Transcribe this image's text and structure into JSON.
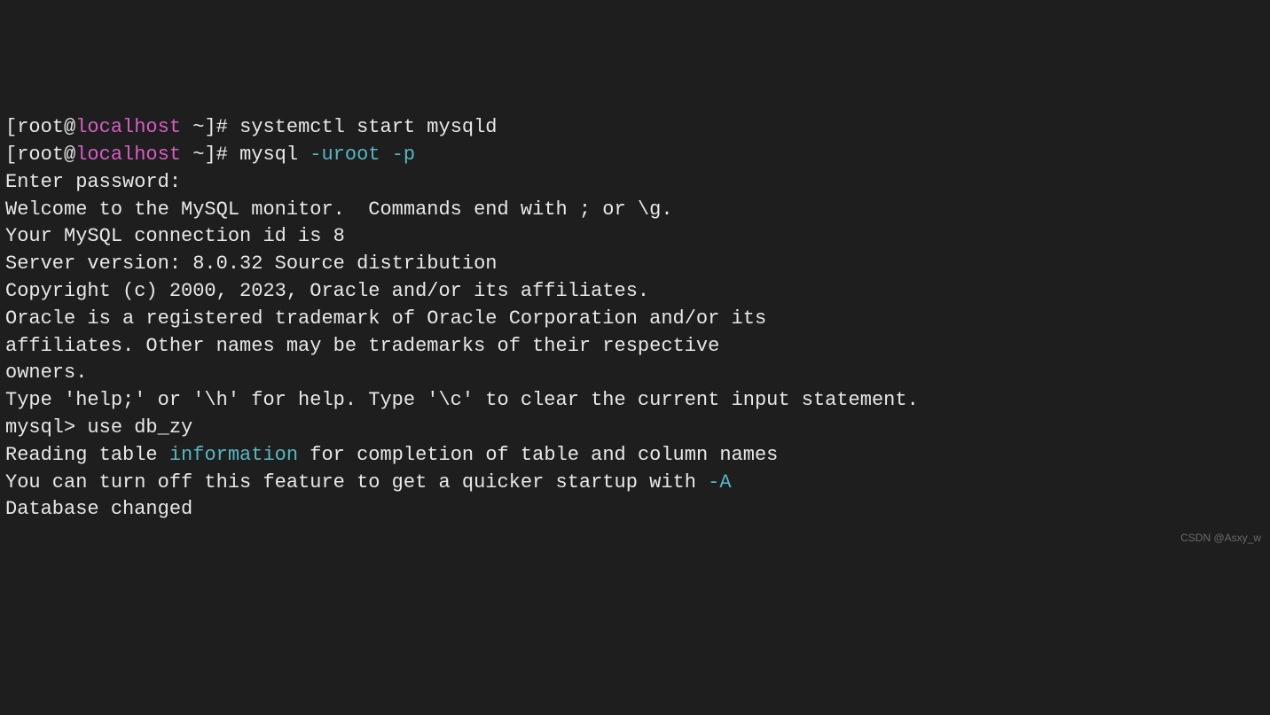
{
  "prompt1": {
    "open": "[",
    "user": "root",
    "at": "@",
    "host": "localhost",
    "rest": " ~]# ",
    "cmd": "systemctl start mysqld"
  },
  "prompt2": {
    "open": "[",
    "user": "root",
    "at": "@",
    "host": "localhost",
    "rest": " ~]# ",
    "cmd": "mysql ",
    "flag1": "-uroot",
    "space": " ",
    "flag2": "-p"
  },
  "lines": {
    "enter_pw": "Enter password:",
    "welcome": "Welcome to the MySQL monitor.  Commands end with ; or \\g.",
    "connid": "Your MySQL connection id is 8",
    "server": "Server version: 8.0.32 Source distribution",
    "blank": "",
    "copyright": "Copyright (c) 2000, 2023, Oracle and/or its affiliates.",
    "trademark1": "Oracle is a registered trademark of Oracle Corporation and/or its",
    "trademark2": "affiliates. Other names may be trademarks of their respective",
    "trademark3": "owners.",
    "help": "Type 'help;' or '\\h' for help. Type '\\c' to clear the current input statement.",
    "mysql_prompt": "mysql> ",
    "use_cmd": "use db_zy",
    "reading1a": "Reading table ",
    "reading1b": "information",
    "reading1c": " for completion of table and column names",
    "reading2a": "You can turn off this feature to get a quicker startup with ",
    "reading2b": "-A",
    "dbchanged": "Database changed"
  },
  "watermark": "CSDN @Asxy_w"
}
